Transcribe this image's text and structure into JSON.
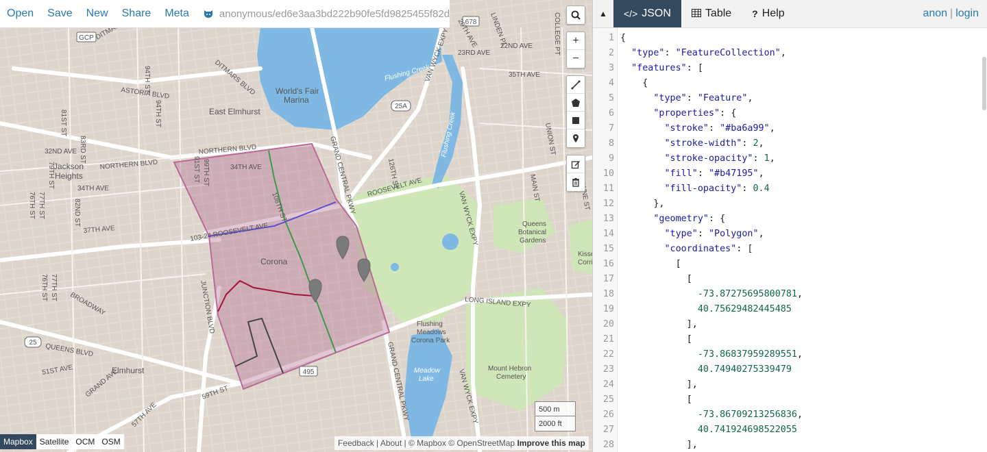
{
  "menu": {
    "open": "Open",
    "save": "Save",
    "new": "New",
    "share": "Share",
    "meta": "Meta",
    "file_path": "anonymous/ed6e3aa3bd222b90fe5fd9825455f82d",
    "file_icon": "github-icon"
  },
  "map": {
    "labels": {
      "gcp": "GCP",
      "ditmars_n": "DITMARS BLVD",
      "ditmars_w": "DITMARS BLVD",
      "astoria_pkwy": "ASTORIA BLVD",
      "grand_central": "GRAND CENTRAL PKWY",
      "grand_central_2": "GRAND CENTRAL PKWY",
      "worlds_fair": "World's Fair",
      "marina": "Marina",
      "flushing_creek": "Flushing Creek",
      "flushing_creek_2": "Flushing Creek",
      "east_elmhurst": "East Elmhurst",
      "northern_blvd": "NORTHERN BLVD",
      "northern_blvd_2": "NORTHERN BLVD",
      "jackson": "Jackson",
      "heights": "Heights",
      "s94": "94TH ST",
      "s81": "81ST ST",
      "s83": "83RD ST",
      "s79": "79TH ST",
      "s77": "77TH ST",
      "s76": "76TH ST",
      "s82": "82ND ST",
      "s99": "99TH ST",
      "s91": "91ST ST",
      "s76b": "76TH ST",
      "s77b": "77TH ST",
      "ave32": "32ND AVE",
      "ave34": "34TH AVE",
      "ave34b": "34TH AVE",
      "ave35": "35TH AVE",
      "ave37": "37TH AVE",
      "roosevelt": "103-24 ROOSEVELT AVE",
      "roosevelt_2": "ROOSEVELT AVE",
      "s108": "108TH ST",
      "s126": "126TH ST",
      "corona": "Corona",
      "junction": "JUNCTION BLVD",
      "broadway": "BROADWAY",
      "queens_blvd": "QUEENS BLVD",
      "ave51": "51ST AVE",
      "grand_ave": "GRAND AVE",
      "elmhurst": "Elmhurst",
      "st59": "59TH ST",
      "ave57": "57TH AVE",
      "ave20": "20TH AVE",
      "ave23": "23RD AVE",
      "ave22": "22ND AVE",
      "ave35b": "35TH AVE",
      "linden": "LINDEN PL",
      "van_wyck": "VAN WYCK EXPY",
      "van_wyck_2": "VAN WYCK EXPY",
      "van_wyck_3": "VAN WYCK EXPY",
      "union": "UNION ST",
      "main": "MAIN ST",
      "bowne": "BOWNE ST",
      "queens_botanical": "Queens",
      "queens_botanical_2": "Botanical",
      "queens_botanical_3": "Gardens",
      "kissena": "Kisse",
      "kissena_2": "Corrido",
      "lie": "LONG ISLAND EXPY",
      "flushing_meadows": "Flushing",
      "flushing_meadows_2": "Meadows",
      "flushing_meadows_3": "Corona Park",
      "meadow_lake": "Meadow",
      "meadow_lake_2": "Lake",
      "mount_hebron": "Mount Hebron",
      "mount_hebron_2": "Cemetery",
      "college_pt": "COLLEGE PT",
      "sign_678": "678",
      "sign_25a": "25A",
      "sign_25": "25",
      "sign_495": "495"
    },
    "layers": [
      "Mapbox",
      "Satellite",
      "OCM",
      "OSM"
    ],
    "active_layer": "Mapbox",
    "scale": [
      "500 m",
      "2000 ft"
    ],
    "attribution": {
      "feedback": "Feedback",
      "about": "About",
      "mapbox": "© Mapbox",
      "osm": "© OpenStreetMap",
      "improve": "Improve this map"
    },
    "polygon_fill": "#b47195",
    "polygon_stroke": "#ba6a99"
  },
  "pane": {
    "tabs": [
      {
        "label": "JSON",
        "icon": "code-icon"
      },
      {
        "label": "Table",
        "icon": "table-icon"
      },
      {
        "label": "Help",
        "icon": "help-icon"
      }
    ],
    "active_tab": "JSON",
    "user": {
      "anon": "anon",
      "separator": "|",
      "login": "login"
    },
    "collapse": "▲"
  },
  "editor": {
    "line_numbers": [
      "1",
      "2",
      "3",
      "4",
      "5",
      "6",
      "7",
      "8",
      "9",
      "10",
      "11",
      "12",
      "13",
      "14",
      "15",
      "16",
      "17",
      "18",
      "19",
      "20",
      "21",
      "22",
      "23",
      "24",
      "25",
      "26",
      "27",
      "28"
    ],
    "lines": [
      "{",
      "  \"type\": \"FeatureCollection\",",
      "  \"features\": [",
      "    {",
      "      \"type\": \"Feature\",",
      "      \"properties\": {",
      "        \"stroke\": \"#ba6a99\",",
      "        \"stroke-width\": 2,",
      "        \"stroke-opacity\": 1,",
      "        \"fill\": \"#b47195\",",
      "        \"fill-opacity\": 0.4",
      "      },",
      "      \"geometry\": {",
      "        \"type\": \"Polygon\",",
      "        \"coordinates\": [",
      "          [",
      "            [",
      "              -73.87275695800781,",
      "              40.75629482445485",
      "            ],",
      "            [",
      "              -73.86837959289551,",
      "              40.74940275339479",
      "            ],",
      "            [",
      "              -73.86709213256836,",
      "              40.741924698522055",
      "            ],"
    ]
  }
}
